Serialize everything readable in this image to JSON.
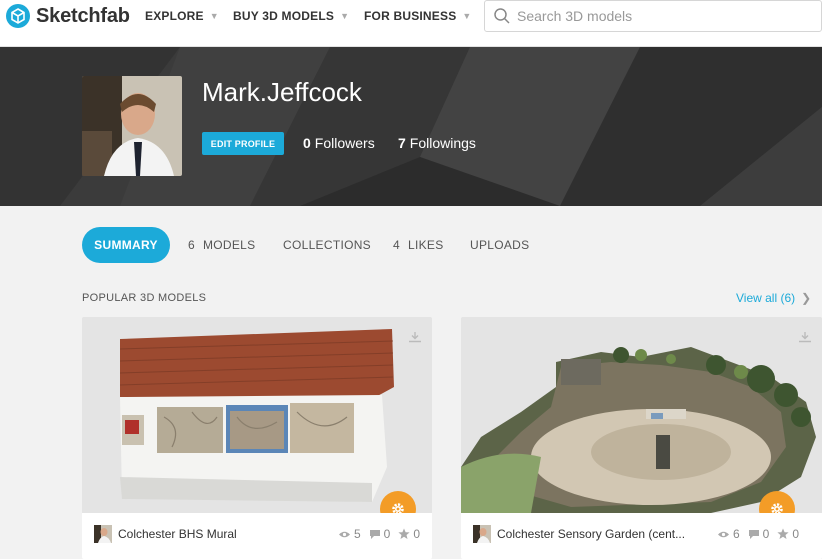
{
  "app": {
    "name": "Sketchfab"
  },
  "nav": {
    "items": [
      {
        "label": "EXPLORE"
      },
      {
        "label": "BUY 3D MODELS"
      },
      {
        "label": "FOR BUSINESS"
      }
    ],
    "search_placeholder": "Search 3D models"
  },
  "profile": {
    "username": "Mark.Jeffcock",
    "edit_label": "EDIT PROFILE",
    "followers_count": "0",
    "followers_label": "Followers",
    "followings_count": "7",
    "followings_label": "Followings"
  },
  "tabs": [
    {
      "count": "",
      "label": "SUMMARY",
      "active": true
    },
    {
      "count": "6",
      "label": "MODELS"
    },
    {
      "count": "",
      "label": "COLLECTIONS"
    },
    {
      "count": "4",
      "label": "LIKES"
    },
    {
      "count": "",
      "label": "UPLOADS"
    }
  ],
  "popular": {
    "heading": "POPULAR 3D MODELS",
    "view_all": "View all (6)"
  },
  "models": [
    {
      "title": "Colchester BHS Mural",
      "views": "5",
      "comments": "0",
      "likes": "0"
    },
    {
      "title": "Colchester Sensory Garden (cent...",
      "views": "6",
      "comments": "0",
      "likes": "0"
    }
  ],
  "colors": {
    "accent": "#1caad9",
    "header_bg": "#3a3a3a",
    "gear": "#f39c27"
  },
  "icons": [
    "sketchfab-logo-icon",
    "search-icon",
    "chevron-down-icon",
    "download-icon",
    "gear-icon",
    "eye-icon",
    "comment-icon",
    "star-icon",
    "chevron-right-icon"
  ]
}
